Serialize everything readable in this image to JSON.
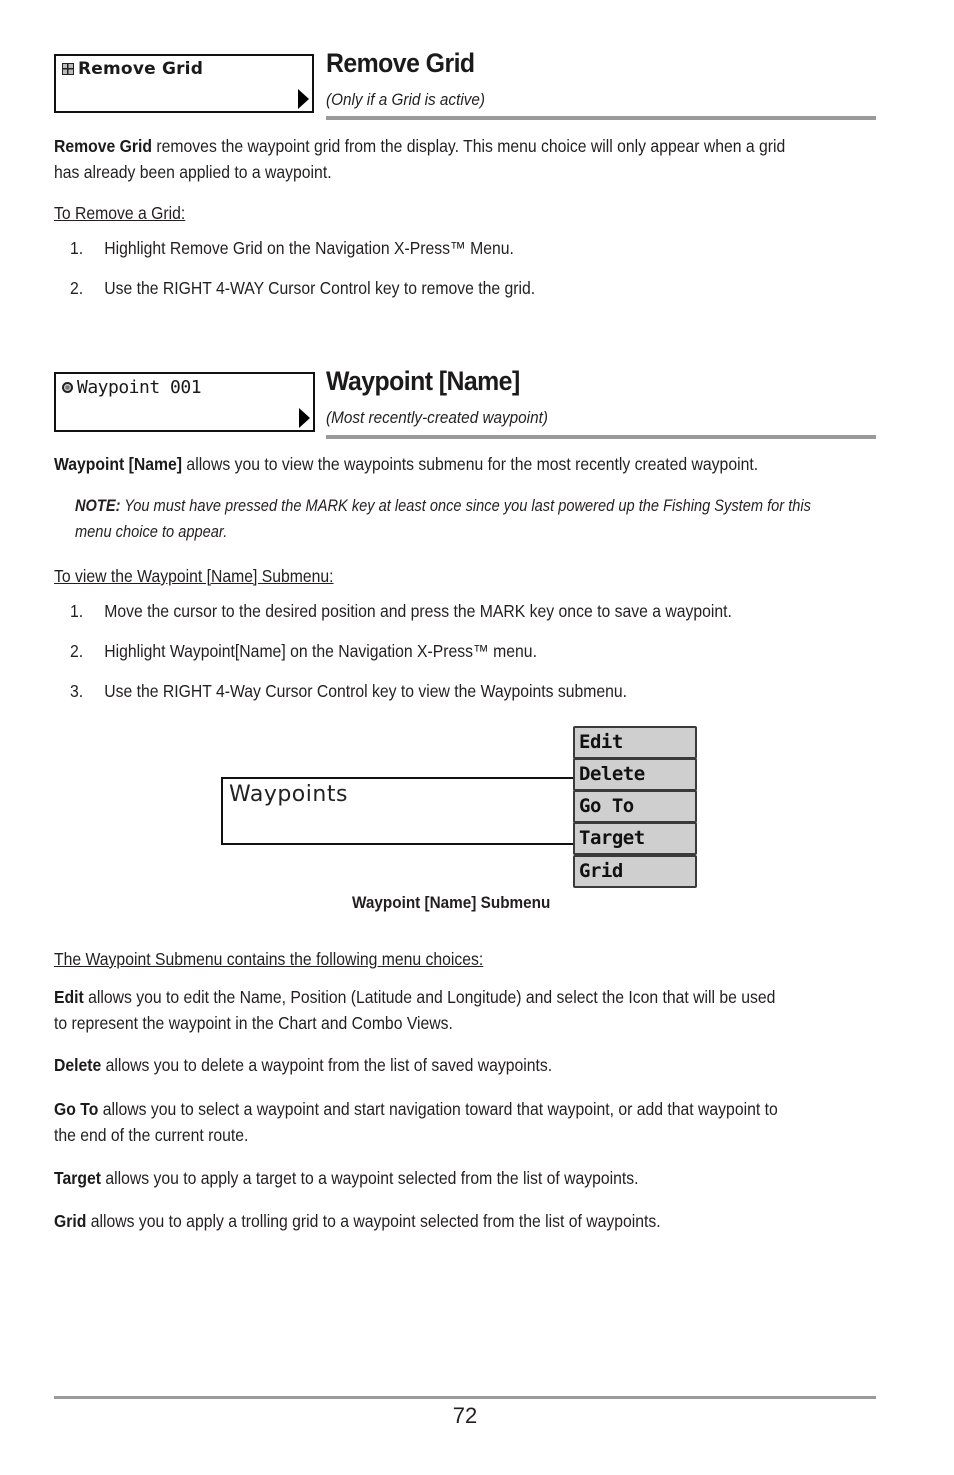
{
  "remove_grid": {
    "menu_label": "Remove Grid",
    "menu_icon": "grid-icon",
    "title": "Remove Grid",
    "subtitle": "(Only if a Grid is active)",
    "intro_bold": "Remove Grid",
    "intro_line1": " removes the waypoint grid from the display. This menu choice will only appear when a grid",
    "intro_line2": "has already been applied to a waypoint.",
    "procedure_heading": "To Remove a Grid:",
    "steps": [
      {
        "num": "1.",
        "text": "Highlight Remove Grid on the Navigation X-Press™ Menu."
      },
      {
        "num": "2.",
        "text": "Use the RIGHT 4-WAY Cursor Control key to remove the grid."
      }
    ]
  },
  "waypoint_name": {
    "menu_label": "Waypoint 001",
    "menu_icon": "waypoint-icon",
    "title": "Waypoint [Name]",
    "subtitle": "(Most recently-created waypoint)",
    "intro_bold": "Waypoint [Name]",
    "intro_rest": " allows you to view the waypoints submenu for the most recently created waypoint.",
    "note_label": "NOTE:",
    "note_line1": " You must have pressed the MARK key at least once since you last powered up the Fishing System for this",
    "note_line2": "menu choice to appear.",
    "procedure_heading": "To view the Waypoint [Name] Submenu:",
    "steps": [
      {
        "num": "1.",
        "text": "Move the cursor to the desired position and press the MARK key once to save a waypoint."
      },
      {
        "num": "2.",
        "text": "Highlight Waypoint[Name] on the Navigation X-Press™ menu."
      },
      {
        "num": "3.",
        "text": "Use the RIGHT 4-Way Cursor Control key to view the Waypoints submenu."
      }
    ]
  },
  "submenu_figure": {
    "parent_label": "Waypoints",
    "items": [
      "Edit",
      "Delete",
      "Go To",
      "Target",
      "Grid"
    ],
    "caption": "Waypoint [Name] Submenu"
  },
  "choices": {
    "heading": "The Waypoint Submenu contains the following menu choices:",
    "entries": [
      {
        "term": "Edit",
        "line1": " allows you to edit the Name, Position (Latitude and Longitude) and select the Icon that will be used",
        "line2": "to represent the waypoint in the Chart and Combo Views."
      },
      {
        "term": "Delete",
        "line1": " allows you to delete a waypoint from the list of saved waypoints.",
        "line2": ""
      },
      {
        "term": "Go To",
        "line1": " allows you to select a waypoint and start navigation toward that waypoint, or add that waypoint to",
        "line2": "the end of the current route."
      },
      {
        "term": "Target",
        "line1": " allows you to apply a target to a waypoint selected from the list of waypoints.",
        "line2": ""
      },
      {
        "term": "Grid",
        "line1": " allows you to apply a trolling grid to a waypoint selected from the list of waypoints.",
        "line2": ""
      }
    ]
  },
  "footer": {
    "page_number": "72"
  },
  "colors": {
    "rule": "#9a9a9a",
    "submenu_item_bg": "#cfcfcf",
    "text": "#231f20"
  }
}
